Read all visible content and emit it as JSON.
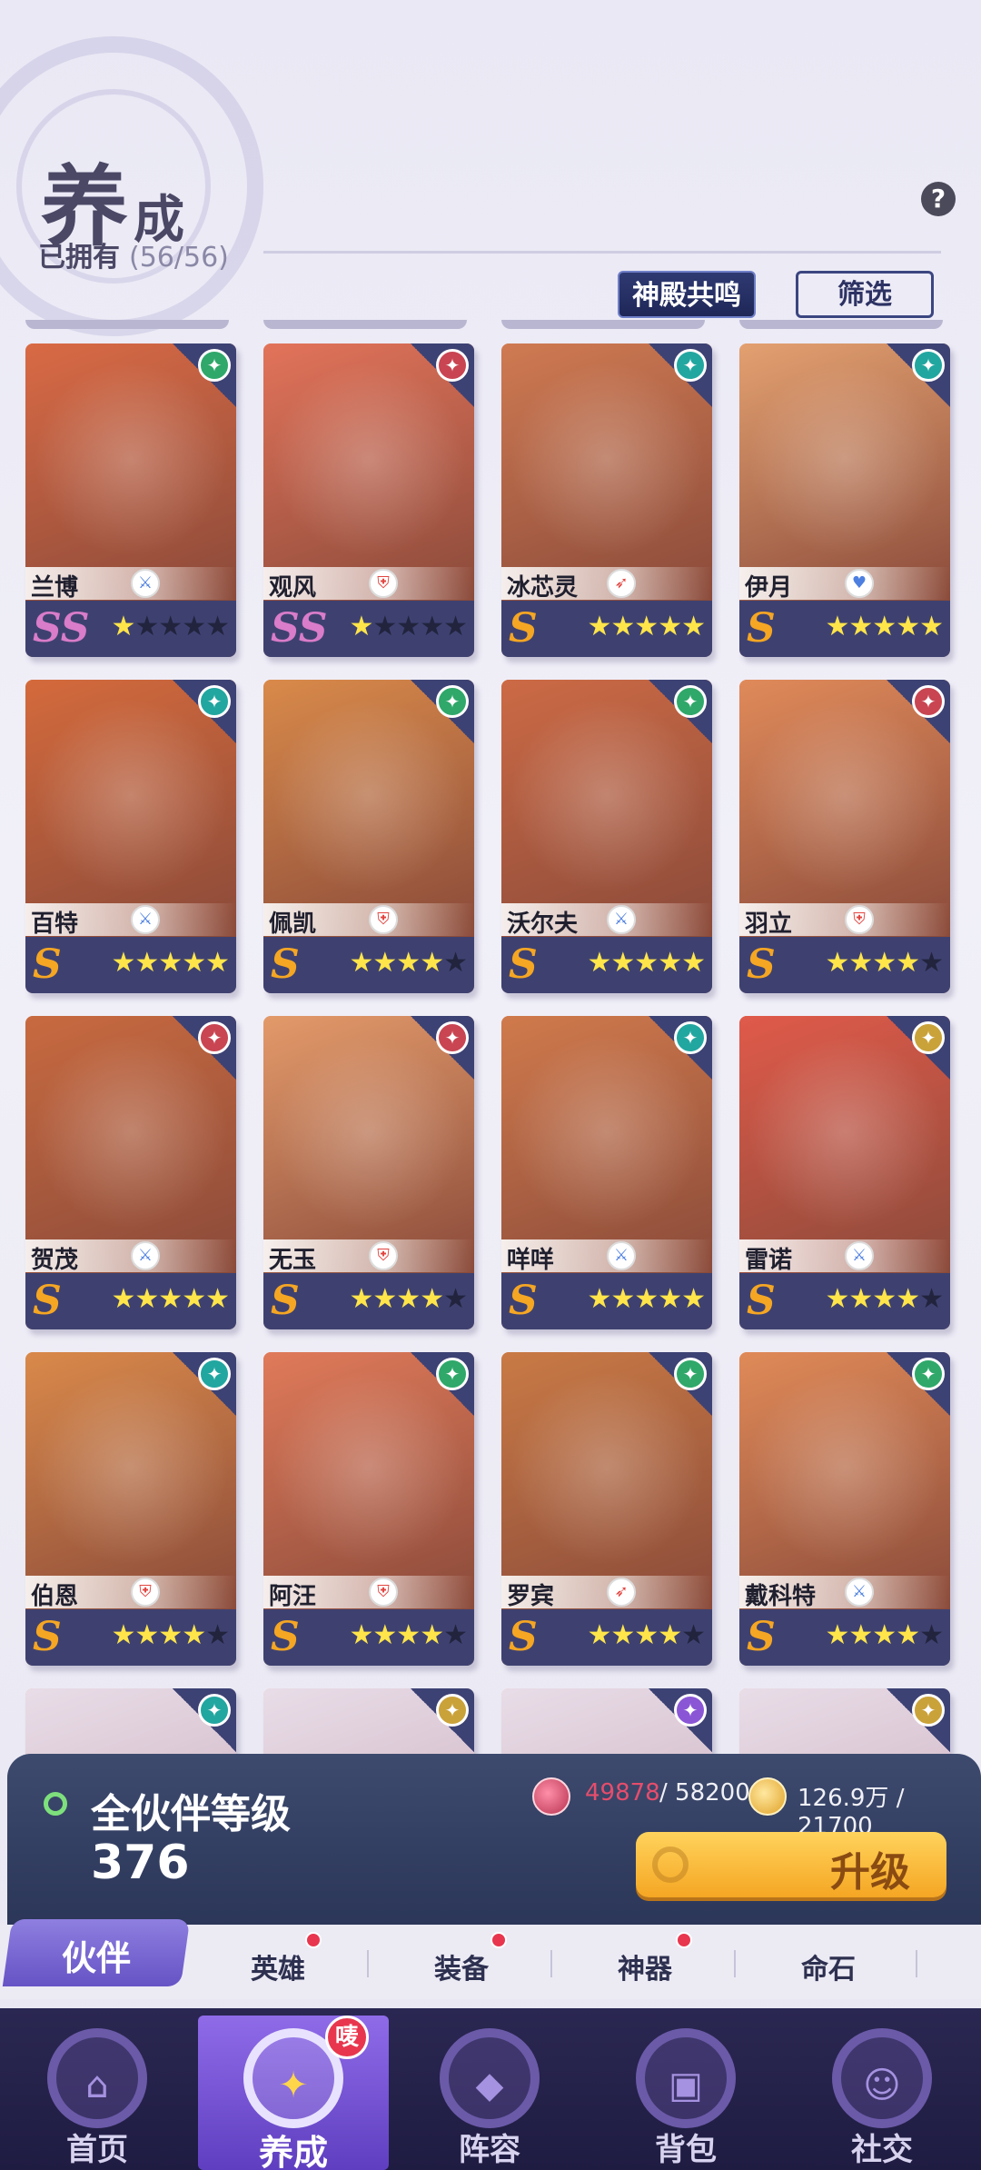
{
  "header": {
    "title_big": "养",
    "title_small": "成",
    "owned_label": "已拥有",
    "owned_count": "(56/56)",
    "help_symbol": "?",
    "resonance_label": "神殿共鸣",
    "filter_label": "筛选"
  },
  "colors": {
    "ss": "#d97cc9",
    "s": "#f5a623",
    "element_green": "#2fa86a",
    "element_red": "#c94552",
    "element_teal": "#22a6a0",
    "element_gold": "#caa23a",
    "element_purple": "#8a56d6"
  },
  "cards": [
    {
      "name": "兰博",
      "grade": "SS",
      "stars": 1,
      "element": "green-element-icon",
      "role": "sword-role-icon",
      "art": "#d96a45"
    },
    {
      "name": "观风",
      "grade": "SS",
      "stars": 1,
      "element": "red-element-icon",
      "role": "shield-role-icon",
      "art": "#e2735a"
    },
    {
      "name": "冰芯灵",
      "grade": "S",
      "stars": 5,
      "element": "teal-element-icon",
      "role": "bow-role-icon",
      "art": "#cf7a52"
    },
    {
      "name": "伊月",
      "grade": "S",
      "stars": 5,
      "element": "teal-element-icon",
      "role": "heart-role-icon",
      "art": "#e3a070"
    },
    {
      "name": "百特",
      "grade": "S",
      "stars": 5,
      "element": "teal-element-icon",
      "role": "sword-role-icon",
      "art": "#d46a3c"
    },
    {
      "name": "佩凯",
      "grade": "S",
      "stars": 4,
      "element": "green-element-icon",
      "role": "shield-role-icon",
      "art": "#d98a4a"
    },
    {
      "name": "沃尔夫",
      "grade": "S",
      "stars": 5,
      "element": "green-element-icon",
      "role": "sword-role-icon",
      "art": "#cc6a45"
    },
    {
      "name": "羽立",
      "grade": "S",
      "stars": 4,
      "element": "red-element-icon",
      "role": "shield-role-icon",
      "art": "#e08a5a"
    },
    {
      "name": "贺茂",
      "grade": "S",
      "stars": 5,
      "element": "red-element-icon",
      "role": "sword-role-icon",
      "art": "#c86a40"
    },
    {
      "name": "无玉",
      "grade": "S",
      "stars": 4,
      "element": "red-element-icon",
      "role": "shield-role-icon",
      "art": "#e39a6a"
    },
    {
      "name": "咩咩",
      "grade": "S",
      "stars": 5,
      "element": "teal-element-icon",
      "role": "sword-role-icon",
      "art": "#d07a4c"
    },
    {
      "name": "雷诺",
      "grade": "S",
      "stars": 4,
      "element": "gold-element-icon",
      "role": "sword-role-icon",
      "art": "#e05a4a"
    },
    {
      "name": "伯恩",
      "grade": "S",
      "stars": 4,
      "element": "teal-element-icon",
      "role": "shield-role-icon",
      "art": "#d9894a"
    },
    {
      "name": "阿汪",
      "grade": "S",
      "stars": 4,
      "element": "green-element-icon",
      "role": "shield-role-icon",
      "art": "#e07a5a"
    },
    {
      "name": "罗宾",
      "grade": "S",
      "stars": 4,
      "element": "green-element-icon",
      "role": "bow-role-icon",
      "art": "#c97a45"
    },
    {
      "name": "戴科特",
      "grade": "S",
      "stars": 4,
      "element": "green-element-icon",
      "role": "sword-role-icon",
      "art": "#e08a58"
    }
  ],
  "partial_row": [
    {
      "element": "teal-element-icon"
    },
    {
      "element": "gold-element-icon"
    },
    {
      "element": "purple-element-icon"
    },
    {
      "element": "gold-element-icon"
    }
  ],
  "level_panel": {
    "label": "全伙伴等级",
    "value": "376",
    "gem_current": "49878",
    "gem_max": "/ 58200",
    "coin_text": "126.9万 / 21700",
    "upgrade_label": "升级"
  },
  "subtabs": {
    "active": "伙伴",
    "items": [
      "英雄",
      "装备",
      "神器",
      "命石"
    ]
  },
  "nav": [
    {
      "label": "首页",
      "icon": "home-icon",
      "glyph": "⌂"
    },
    {
      "label": "养成",
      "icon": "star-hexagram-icon",
      "glyph": "✦",
      "badge": "唛"
    },
    {
      "label": "阵容",
      "icon": "formation-icon",
      "glyph": "◆"
    },
    {
      "label": "背包",
      "icon": "backpack-icon",
      "glyph": "▣"
    },
    {
      "label": "社交",
      "icon": "social-icon",
      "glyph": "☺"
    }
  ]
}
